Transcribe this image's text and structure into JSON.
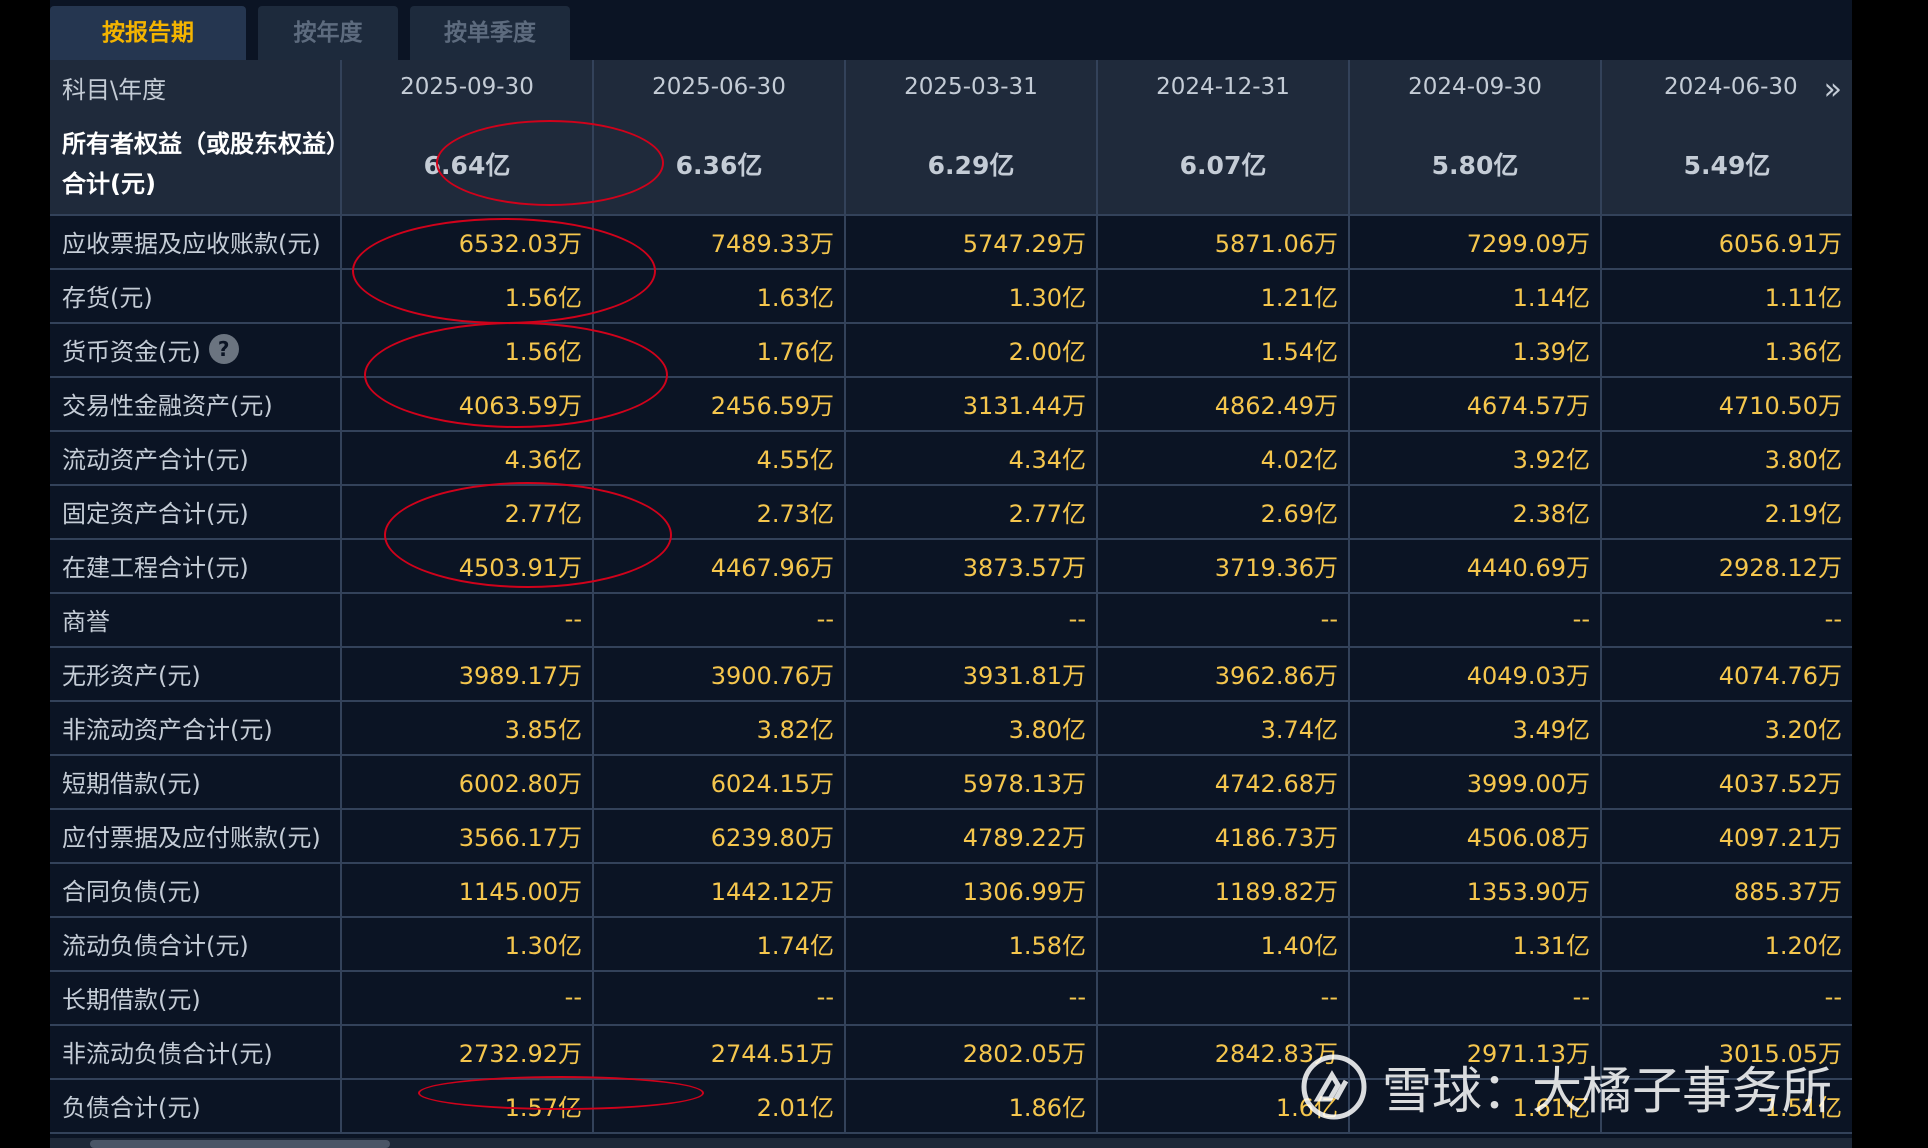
{
  "tabs": [
    "按报告期",
    "按年度",
    "按单季度"
  ],
  "header": {
    "label": "科目\\年度",
    "periods": [
      "2025-09-30",
      "2025-06-30",
      "2025-03-31",
      "2024-12-31",
      "2024-09-30",
      "2024-06-30"
    ]
  },
  "rows": [
    {
      "label": "所有者权益（或股东权益）合计(元)",
      "values": [
        "6.64亿",
        "6.36亿",
        "6.29亿",
        "6.07亿",
        "5.80亿",
        "5.49亿"
      ]
    },
    {
      "label": "应收票据及应收账款(元)",
      "values": [
        "6532.03万",
        "7489.33万",
        "5747.29万",
        "5871.06万",
        "7299.09万",
        "6056.91万"
      ]
    },
    {
      "label": "存货(元)",
      "values": [
        "1.56亿",
        "1.63亿",
        "1.30亿",
        "1.21亿",
        "1.14亿",
        "1.11亿"
      ]
    },
    {
      "label": "货币资金(元)",
      "values": [
        "1.56亿",
        "1.76亿",
        "2.00亿",
        "1.54亿",
        "1.39亿",
        "1.36亿"
      ]
    },
    {
      "label": "交易性金融资产(元)",
      "values": [
        "4063.59万",
        "2456.59万",
        "3131.44万",
        "4862.49万",
        "4674.57万",
        "4710.50万"
      ]
    },
    {
      "label": "流动资产合计(元)",
      "values": [
        "4.36亿",
        "4.55亿",
        "4.34亿",
        "4.02亿",
        "3.92亿",
        "3.80亿"
      ]
    },
    {
      "label": "固定资产合计(元)",
      "values": [
        "2.77亿",
        "2.73亿",
        "2.77亿",
        "2.69亿",
        "2.38亿",
        "2.19亿"
      ]
    },
    {
      "label": "在建工程合计(元)",
      "values": [
        "4503.91万",
        "4467.96万",
        "3873.57万",
        "3719.36万",
        "4440.69万",
        "2928.12万"
      ]
    },
    {
      "label": "商誉",
      "values": [
        "--",
        "--",
        "--",
        "--",
        "--",
        "--"
      ]
    },
    {
      "label": "无形资产(元)",
      "values": [
        "3989.17万",
        "3900.76万",
        "3931.81万",
        "3962.86万",
        "4049.03万",
        "4074.76万"
      ]
    },
    {
      "label": "非流动资产合计(元)",
      "values": [
        "3.85亿",
        "3.82亿",
        "3.80亿",
        "3.74亿",
        "3.49亿",
        "3.20亿"
      ]
    },
    {
      "label": "短期借款(元)",
      "values": [
        "6002.80万",
        "6024.15万",
        "5978.13万",
        "4742.68万",
        "3999.00万",
        "4037.52万"
      ]
    },
    {
      "label": "应付票据及应付账款(元)",
      "values": [
        "3566.17万",
        "6239.80万",
        "4789.22万",
        "4186.73万",
        "4506.08万",
        "4097.21万"
      ]
    },
    {
      "label": "合同负债(元)",
      "values": [
        "1145.00万",
        "1442.12万",
        "1306.99万",
        "1189.82万",
        "1353.90万",
        "885.37万"
      ]
    },
    {
      "label": "流动负债合计(元)",
      "values": [
        "1.30亿",
        "1.74亿",
        "1.58亿",
        "1.40亿",
        "1.31亿",
        "1.20亿"
      ]
    },
    {
      "label": "长期借款(元)",
      "values": [
        "--",
        "--",
        "--",
        "--",
        "--",
        "--"
      ]
    },
    {
      "label": "非流动负债合计(元)",
      "values": [
        "2732.92万",
        "2744.51万",
        "2802.05万",
        "2842.83万",
        "2971.13万",
        "3015.05万"
      ]
    },
    {
      "label": "负债合计(元)",
      "values": [
        "1.57亿",
        "2.01亿",
        "1.86亿",
        "1.6亿",
        "1.61亿",
        "1.51亿"
      ]
    }
  ],
  "help_icon": "?",
  "next_icon": "»",
  "watermark": "雪球：大橘子事务所",
  "colors": {
    "accent": "#f4b400",
    "value": "#f5c64d",
    "annotation": "#d0021b"
  }
}
